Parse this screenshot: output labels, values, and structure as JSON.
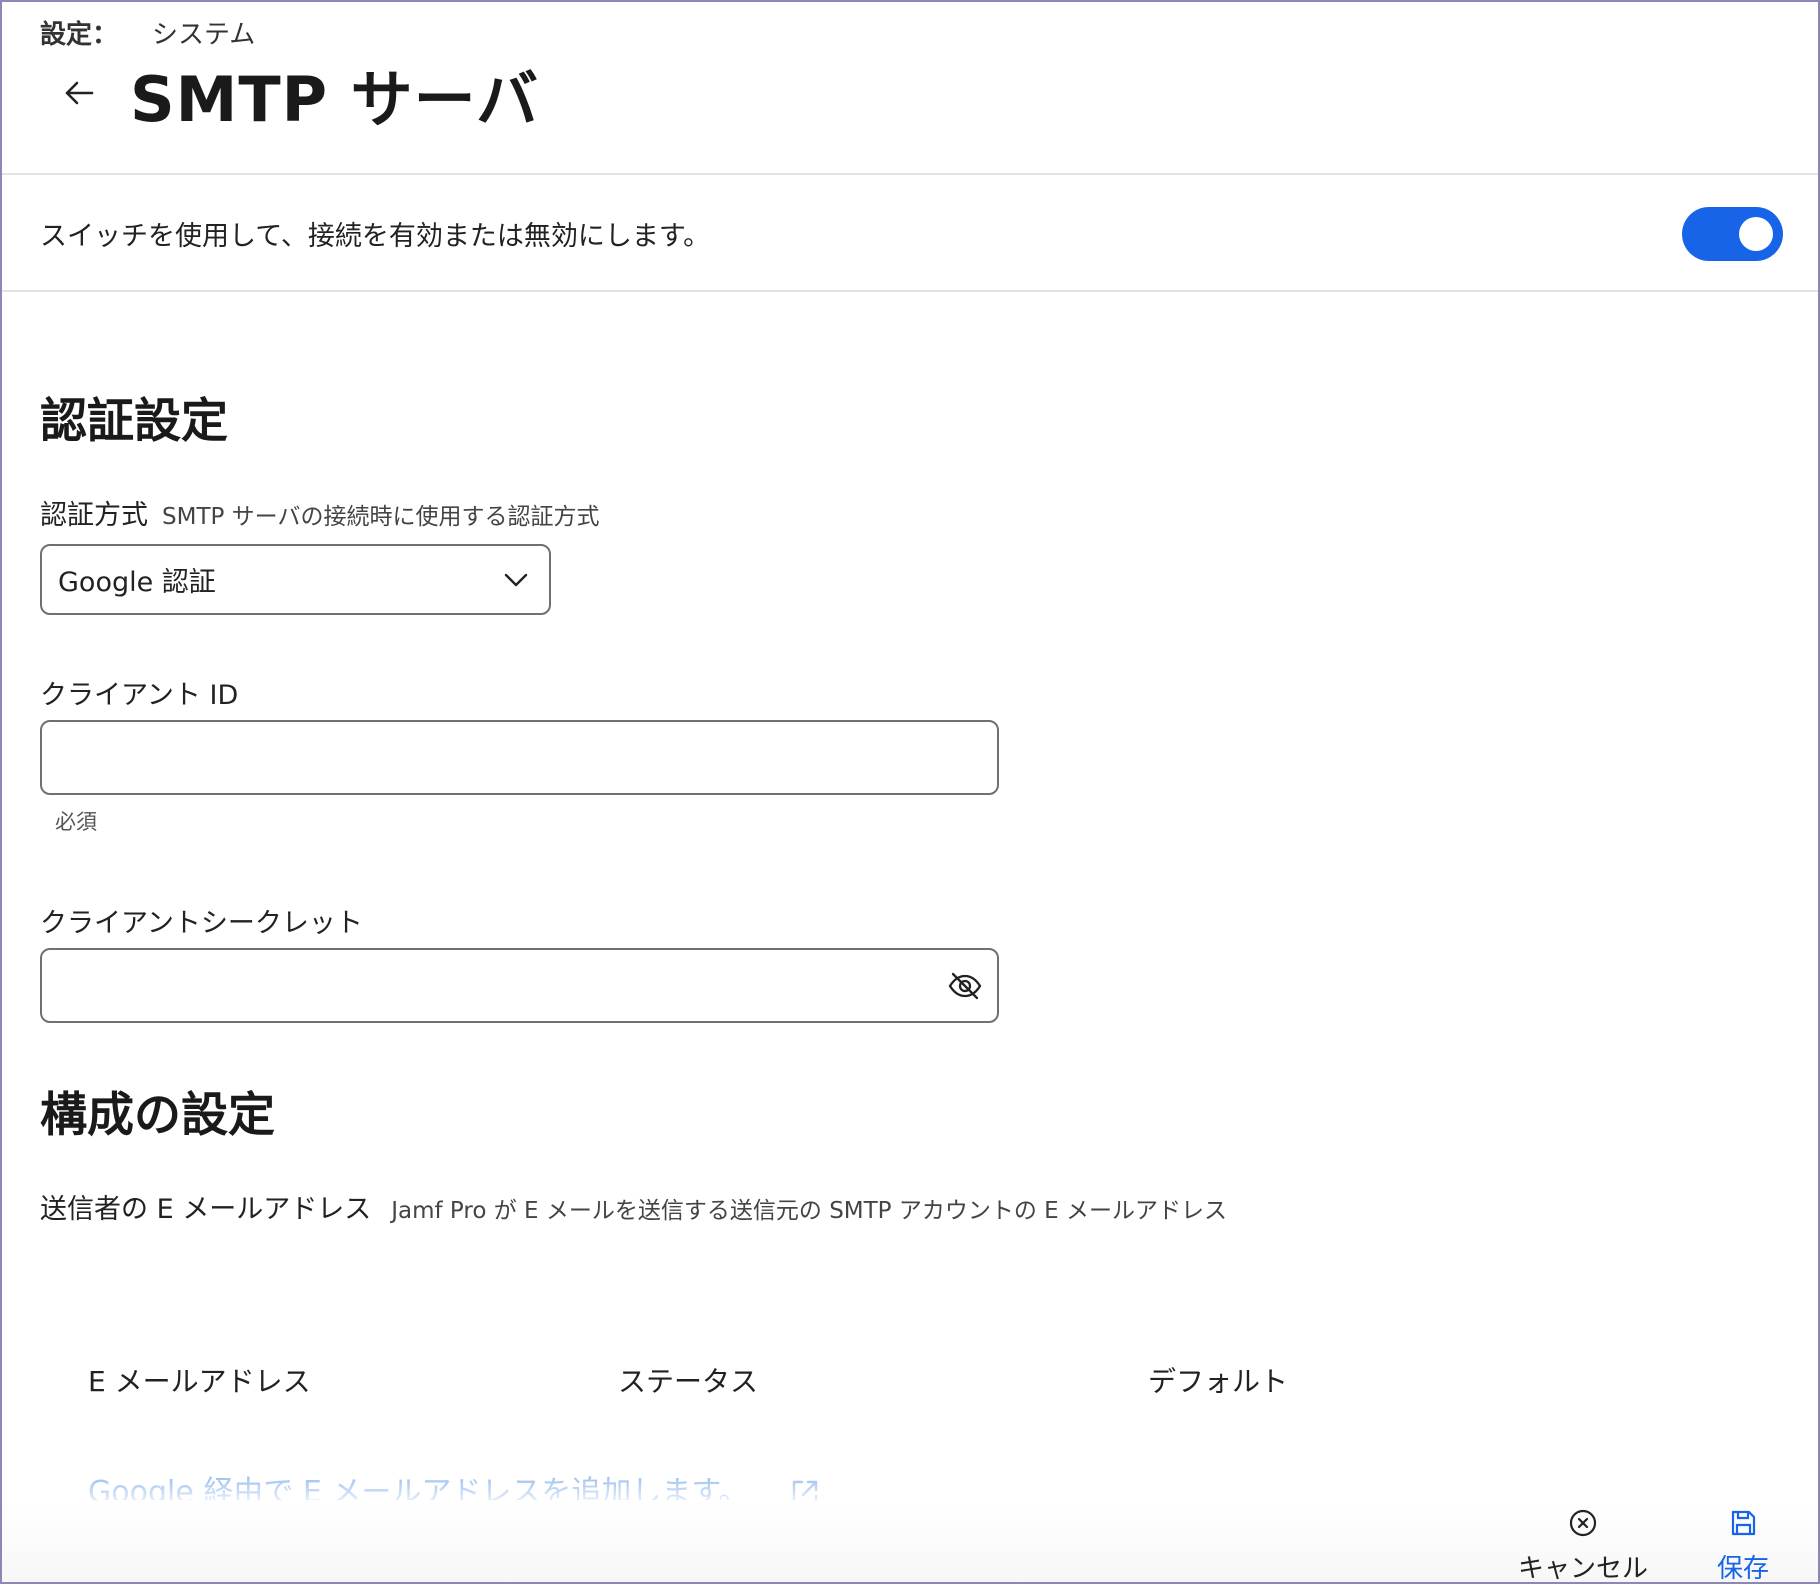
{
  "breadcrumb": {
    "root": "設定：",
    "current": "システム"
  },
  "header": {
    "title": "SMTP サーバ"
  },
  "connection": {
    "toggle_text": "スイッチを使用して、接続を有効または無効にします。",
    "enabled": true,
    "accent_color": "#1764e8"
  },
  "auth_section": {
    "title": "認証設定",
    "method_label": "認証方式",
    "method_hint": "SMTP サーバの接続時に使用する認証方式",
    "method_value": "Google 認証",
    "client_id_label": "クライアント ID",
    "client_id_value": "",
    "required_note": "必須",
    "client_secret_label": "クライアントシークレット",
    "client_secret_value": ""
  },
  "config_section": {
    "title": "構成の設定",
    "sender_label": "送信者の E メールアドレス",
    "sender_hint": "Jamf Pro が E メールを送信する送信元の SMTP アカウントの E メールアドレス",
    "table_headers": [
      "E メールアドレス",
      "ステータス",
      "デフォルト"
    ],
    "add_link": "Google 経由で E メールアドレスを追加します。"
  },
  "footer": {
    "cancel_label": "キャンセル",
    "save_label": "保存"
  }
}
